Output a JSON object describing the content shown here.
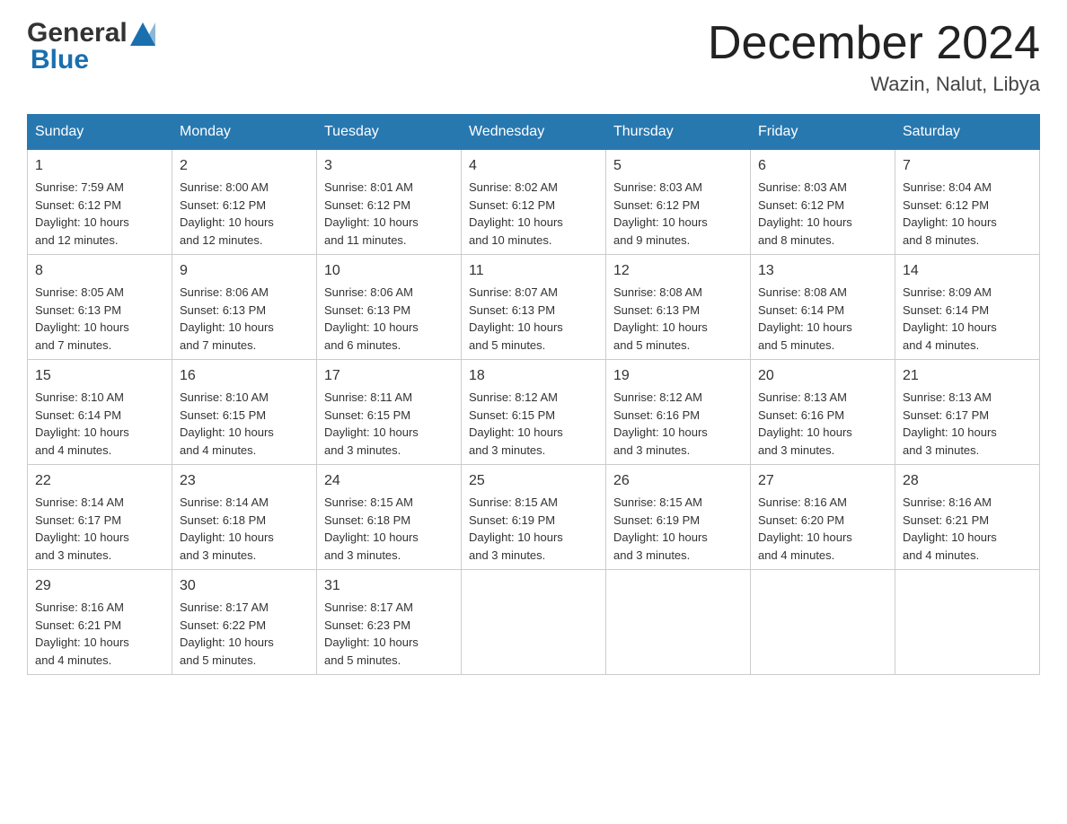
{
  "header": {
    "logo_general": "General",
    "logo_blue": "Blue",
    "month_title": "December 2024",
    "location": "Wazin, Nalut, Libya"
  },
  "weekdays": [
    "Sunday",
    "Monday",
    "Tuesday",
    "Wednesday",
    "Thursday",
    "Friday",
    "Saturday"
  ],
  "weeks": [
    [
      {
        "day": "1",
        "sunrise": "7:59 AM",
        "sunset": "6:12 PM",
        "daylight": "10 hours and 12 minutes."
      },
      {
        "day": "2",
        "sunrise": "8:00 AM",
        "sunset": "6:12 PM",
        "daylight": "10 hours and 12 minutes."
      },
      {
        "day": "3",
        "sunrise": "8:01 AM",
        "sunset": "6:12 PM",
        "daylight": "10 hours and 11 minutes."
      },
      {
        "day": "4",
        "sunrise": "8:02 AM",
        "sunset": "6:12 PM",
        "daylight": "10 hours and 10 minutes."
      },
      {
        "day": "5",
        "sunrise": "8:03 AM",
        "sunset": "6:12 PM",
        "daylight": "10 hours and 9 minutes."
      },
      {
        "day": "6",
        "sunrise": "8:03 AM",
        "sunset": "6:12 PM",
        "daylight": "10 hours and 8 minutes."
      },
      {
        "day": "7",
        "sunrise": "8:04 AM",
        "sunset": "6:12 PM",
        "daylight": "10 hours and 8 minutes."
      }
    ],
    [
      {
        "day": "8",
        "sunrise": "8:05 AM",
        "sunset": "6:13 PM",
        "daylight": "10 hours and 7 minutes."
      },
      {
        "day": "9",
        "sunrise": "8:06 AM",
        "sunset": "6:13 PM",
        "daylight": "10 hours and 7 minutes."
      },
      {
        "day": "10",
        "sunrise": "8:06 AM",
        "sunset": "6:13 PM",
        "daylight": "10 hours and 6 minutes."
      },
      {
        "day": "11",
        "sunrise": "8:07 AM",
        "sunset": "6:13 PM",
        "daylight": "10 hours and 5 minutes."
      },
      {
        "day": "12",
        "sunrise": "8:08 AM",
        "sunset": "6:13 PM",
        "daylight": "10 hours and 5 minutes."
      },
      {
        "day": "13",
        "sunrise": "8:08 AM",
        "sunset": "6:14 PM",
        "daylight": "10 hours and 5 minutes."
      },
      {
        "day": "14",
        "sunrise": "8:09 AM",
        "sunset": "6:14 PM",
        "daylight": "10 hours and 4 minutes."
      }
    ],
    [
      {
        "day": "15",
        "sunrise": "8:10 AM",
        "sunset": "6:14 PM",
        "daylight": "10 hours and 4 minutes."
      },
      {
        "day": "16",
        "sunrise": "8:10 AM",
        "sunset": "6:15 PM",
        "daylight": "10 hours and 4 minutes."
      },
      {
        "day": "17",
        "sunrise": "8:11 AM",
        "sunset": "6:15 PM",
        "daylight": "10 hours and 3 minutes."
      },
      {
        "day": "18",
        "sunrise": "8:12 AM",
        "sunset": "6:15 PM",
        "daylight": "10 hours and 3 minutes."
      },
      {
        "day": "19",
        "sunrise": "8:12 AM",
        "sunset": "6:16 PM",
        "daylight": "10 hours and 3 minutes."
      },
      {
        "day": "20",
        "sunrise": "8:13 AM",
        "sunset": "6:16 PM",
        "daylight": "10 hours and 3 minutes."
      },
      {
        "day": "21",
        "sunrise": "8:13 AM",
        "sunset": "6:17 PM",
        "daylight": "10 hours and 3 minutes."
      }
    ],
    [
      {
        "day": "22",
        "sunrise": "8:14 AM",
        "sunset": "6:17 PM",
        "daylight": "10 hours and 3 minutes."
      },
      {
        "day": "23",
        "sunrise": "8:14 AM",
        "sunset": "6:18 PM",
        "daylight": "10 hours and 3 minutes."
      },
      {
        "day": "24",
        "sunrise": "8:15 AM",
        "sunset": "6:18 PM",
        "daylight": "10 hours and 3 minutes."
      },
      {
        "day": "25",
        "sunrise": "8:15 AM",
        "sunset": "6:19 PM",
        "daylight": "10 hours and 3 minutes."
      },
      {
        "day": "26",
        "sunrise": "8:15 AM",
        "sunset": "6:19 PM",
        "daylight": "10 hours and 3 minutes."
      },
      {
        "day": "27",
        "sunrise": "8:16 AM",
        "sunset": "6:20 PM",
        "daylight": "10 hours and 4 minutes."
      },
      {
        "day": "28",
        "sunrise": "8:16 AM",
        "sunset": "6:21 PM",
        "daylight": "10 hours and 4 minutes."
      }
    ],
    [
      {
        "day": "29",
        "sunrise": "8:16 AM",
        "sunset": "6:21 PM",
        "daylight": "10 hours and 4 minutes."
      },
      {
        "day": "30",
        "sunrise": "8:17 AM",
        "sunset": "6:22 PM",
        "daylight": "10 hours and 5 minutes."
      },
      {
        "day": "31",
        "sunrise": "8:17 AM",
        "sunset": "6:23 PM",
        "daylight": "10 hours and 5 minutes."
      },
      null,
      null,
      null,
      null
    ]
  ],
  "labels": {
    "sunrise": "Sunrise:",
    "sunset": "Sunset:",
    "daylight": "Daylight:"
  }
}
